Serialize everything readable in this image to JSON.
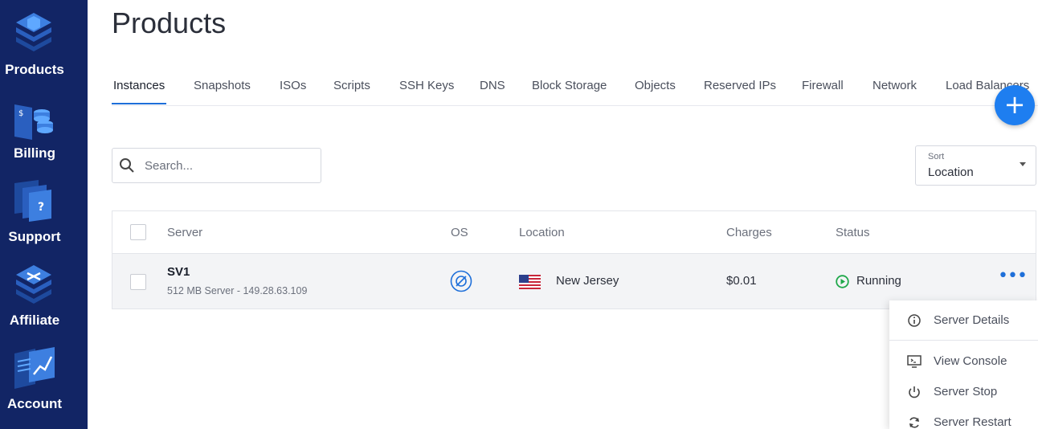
{
  "sidebar": {
    "items": [
      {
        "label": "Products",
        "icon": "products-icon"
      },
      {
        "label": "Billing",
        "icon": "billing-icon"
      },
      {
        "label": "Support",
        "icon": "support-icon"
      },
      {
        "label": "Affiliate",
        "icon": "affiliate-icon"
      },
      {
        "label": "Account",
        "icon": "account-icon"
      }
    ]
  },
  "header": {
    "title": "Products"
  },
  "tabs": [
    {
      "label": "Instances",
      "active": true
    },
    {
      "label": "Snapshots"
    },
    {
      "label": "ISOs"
    },
    {
      "label": "Scripts"
    },
    {
      "label": "SSH Keys"
    },
    {
      "label": "DNS"
    },
    {
      "label": "Block Storage"
    },
    {
      "label": "Objects"
    },
    {
      "label": "Reserved IPs"
    },
    {
      "label": "Firewall"
    },
    {
      "label": "Network"
    },
    {
      "label": "Load Balancers"
    }
  ],
  "fab": {
    "label": "+"
  },
  "search": {
    "placeholder": "Search..."
  },
  "sort": {
    "label": "Sort",
    "value": "Location"
  },
  "table": {
    "headers": {
      "server": "Server",
      "os": "OS",
      "location": "Location",
      "charges": "Charges",
      "status": "Status"
    },
    "rows": [
      {
        "name": "SV1",
        "subtitle": "512 MB Server - 149.28.63.109",
        "location": "New Jersey",
        "charges": "$0.01",
        "status": "Running"
      }
    ]
  },
  "menu": {
    "items": [
      {
        "label": "Server Details",
        "icon": "info-icon"
      },
      {
        "label": "View Console",
        "icon": "console-icon"
      },
      {
        "label": "Server Stop",
        "icon": "power-icon"
      },
      {
        "label": "Server Restart",
        "icon": "restart-icon"
      }
    ]
  },
  "colors": {
    "sidebar": "#122565",
    "accent": "#1e6fd9",
    "fab": "#1e7ef0",
    "running": "#1fa84a"
  }
}
